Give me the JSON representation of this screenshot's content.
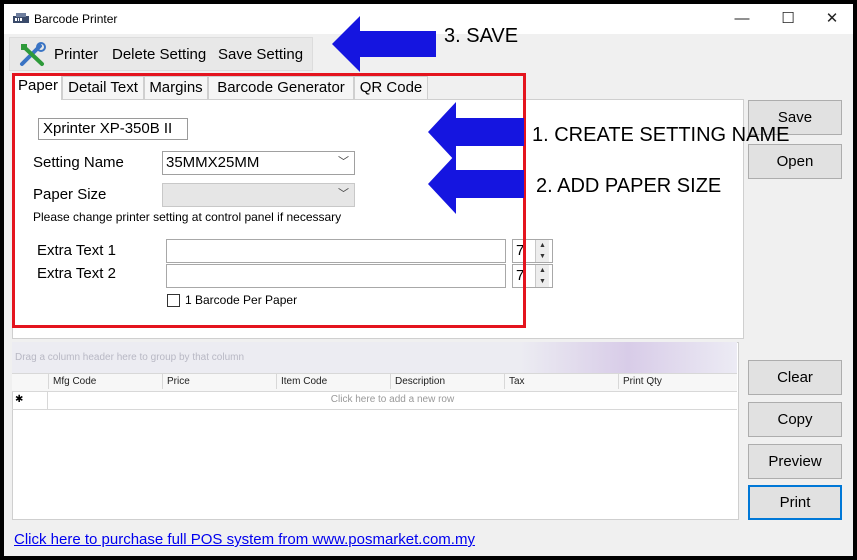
{
  "window": {
    "title": "Barcode Printer",
    "minimize": "—",
    "maximize": "☐",
    "close": "✕"
  },
  "toolbar": {
    "printer_label": "Printer",
    "delete_label": "Delete Setting",
    "save_label": "Save Setting"
  },
  "tabs": [
    {
      "label": "Paper",
      "active": true
    },
    {
      "label": "Detail Text"
    },
    {
      "label": "Margins"
    },
    {
      "label": "Barcode Generator"
    },
    {
      "label": "QR Code"
    }
  ],
  "paper": {
    "printer_name": "Xprinter XP-350B II",
    "setting_name_label": "Setting Name",
    "setting_name_value": "35MMX25MM",
    "paper_size_label": "Paper Size",
    "paper_size_value": "",
    "note": "Please change printer setting at control panel if necessary",
    "extra_text_1_label": "Extra Text 1",
    "extra_text_1_value": "",
    "extra_text_1_size": "7",
    "extra_text_2_label": "Extra Text 2",
    "extra_text_2_value": "",
    "extra_text_2_size": "7",
    "barcode_per_paper_label": "1 Barcode Per Paper"
  },
  "side_buttons": {
    "save": "Save",
    "open": "Open",
    "clear": "Clear",
    "copy": "Copy",
    "preview": "Preview",
    "print": "Print"
  },
  "grid": {
    "group_text": "Drag a column header here to group by that column",
    "columns": [
      "Mfg Code",
      "Price",
      "Item Code",
      "Description",
      "Tax",
      "Print Qty"
    ],
    "new_row_indicator": "✱",
    "new_row_text": "Click here to add a new row"
  },
  "footer": {
    "link_text": "Click here to purchase full POS system from www.posmarket.com.my"
  },
  "annotations": {
    "step1": "1. CREATE SETTING NAME",
    "step2": "2. ADD PAPER SIZE",
    "step3": "3. SAVE",
    "arrow_color": "#1515e0",
    "highlight_color": "#e4141e"
  }
}
